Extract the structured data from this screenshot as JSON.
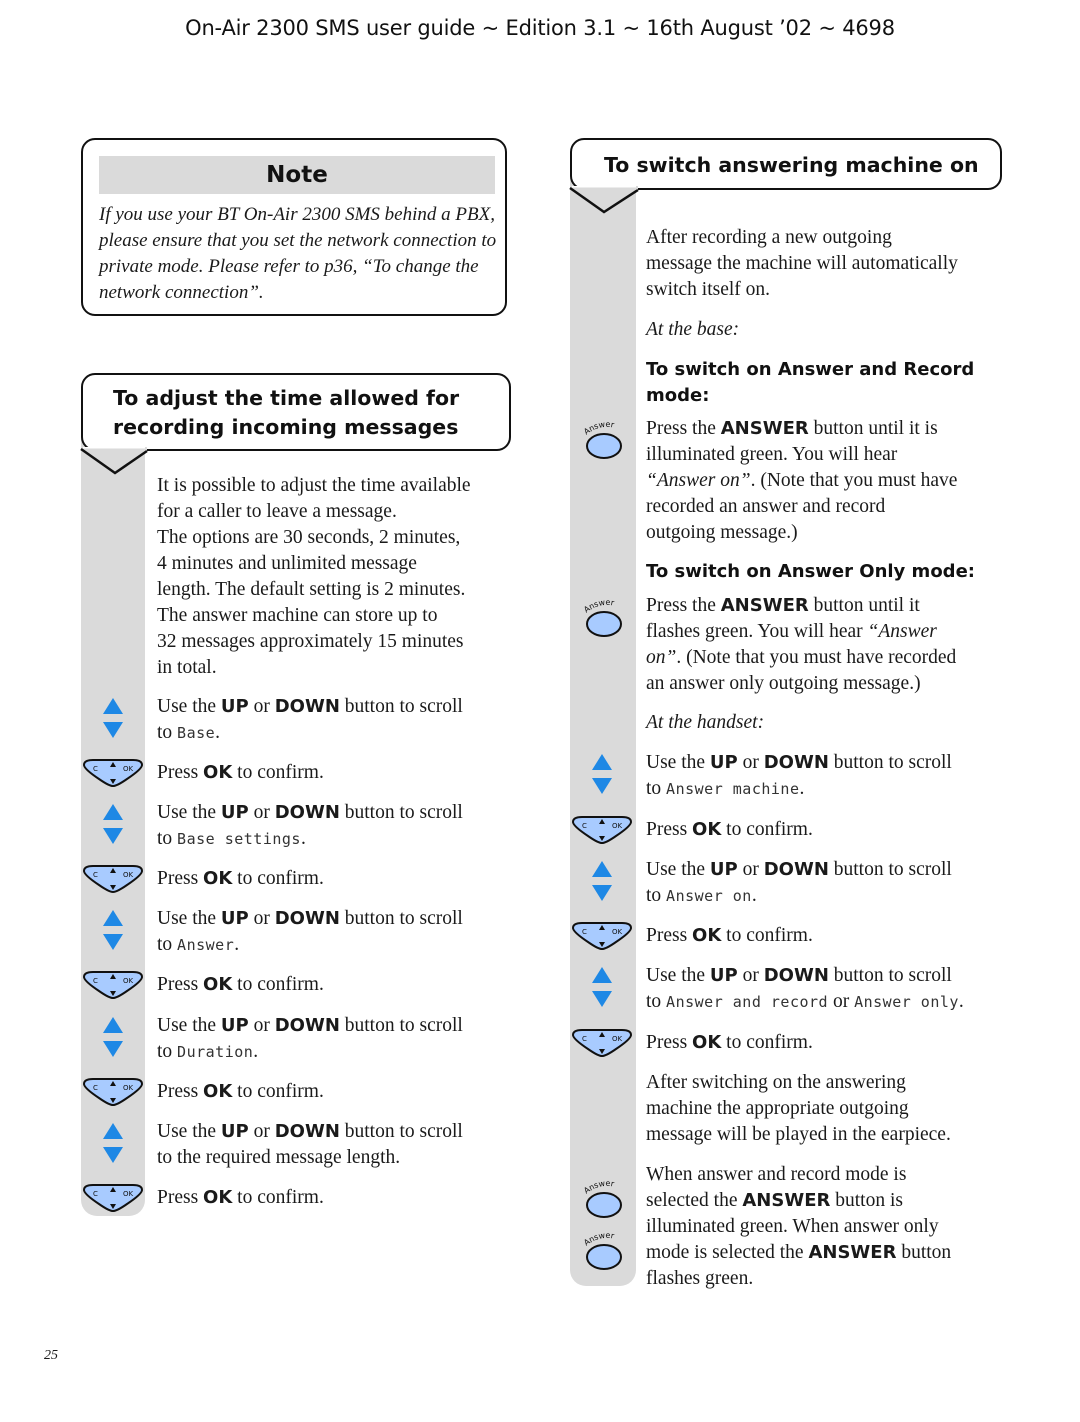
{
  "header": {
    "title": "On-Air 2300 SMS user guide ~ Edition 3.1 ~ 16th August ’02 ~ 4698"
  },
  "note": {
    "title": "Note",
    "text": "If you use your BT On-Air 2300 SMS behind a PBX, please ensure that you set the network connection to private mode. Please refer to p36, “To change the network connection”."
  },
  "left_section": {
    "title_line1": "To adjust the time allowed for",
    "title_line2": "recording incoming messages",
    "intro": [
      "It is possible to adjust the time available",
      "for a caller to leave a message.",
      "The options are 30 seconds, 2 minutes,",
      "4 minutes and unlimited message",
      "length. The default setting is 2 minutes.",
      "The answer machine can store up to",
      "32 messages approximately 15 minutes",
      "in total."
    ],
    "steps": [
      {
        "type": "scroll",
        "pre": "Use the",
        "up": "UP",
        "or": "or",
        "down": "DOWN",
        "post": "button to scroll",
        "to": "to",
        "target": "Base",
        "end": "."
      },
      {
        "type": "ok",
        "pre": "Press",
        "key": "OK",
        "post": "to confirm."
      },
      {
        "type": "scroll",
        "pre": "Use the",
        "up": "UP",
        "or": "or",
        "down": "DOWN",
        "post": "button to scroll",
        "to": "to",
        "target": "Base settings",
        "end": "."
      },
      {
        "type": "ok",
        "pre": "Press",
        "key": "OK",
        "post": "to confirm."
      },
      {
        "type": "scroll",
        "pre": "Use the",
        "up": "UP",
        "or": "or",
        "down": "DOWN",
        "post": "button to scroll",
        "to": "to",
        "target": "Answer",
        "end": "."
      },
      {
        "type": "ok",
        "pre": "Press",
        "key": "OK",
        "post": "to confirm."
      },
      {
        "type": "scroll",
        "pre": "Use the",
        "up": "UP",
        "or": "or",
        "down": "DOWN",
        "post": "button to scroll",
        "to": "to",
        "target": "Duration",
        "end": "."
      },
      {
        "type": "ok",
        "pre": "Press",
        "key": "OK",
        "post": "to confirm."
      },
      {
        "type": "scroll",
        "pre": "Use  the",
        "up": "UP",
        "or": "or",
        "down": "DOWN",
        "post": "button to scroll",
        "to": "to the required message length.",
        "target": "",
        "end": ""
      },
      {
        "type": "ok",
        "pre": "Press",
        "key": "OK",
        "post": "to confirm."
      }
    ]
  },
  "right_section": {
    "title": "To switch answering machine on",
    "intro": [
      "After recording a new outgoing",
      "message the machine will automatically",
      "switch itself on."
    ],
    "at_base": "At the base:",
    "sub1": {
      "line1": "To switch on Answer and Record",
      "line2": "mode:"
    },
    "sub1_text": {
      "p1": "Press the",
      "key": "ANSWER",
      "p2": "button until it is",
      "l2": "illuminated green. You will hear",
      "q": "“Answer on”",
      "l3": ". (Note that you must have",
      "l4": "recorded an answer and record",
      "l5": "outgoing message.)"
    },
    "sub2": "To switch on Answer Only mode:",
    "sub2_text": {
      "p1": "Press the",
      "key": "ANSWER",
      "p2": "button until it",
      "l2a": "flashes green. You will hear",
      "q1": "“Answer",
      "q2": "on”",
      "l3": ". (Note that you must have recorded",
      "l4": "an answer only outgoing message.)"
    },
    "at_handset": "At the handset:",
    "steps": [
      {
        "type": "scroll",
        "pre": "Use the",
        "up": "UP",
        "or": "or",
        "down": "DOWN",
        "post": "button to scroll",
        "to": "to",
        "target": "Answer machine",
        "end": "."
      },
      {
        "type": "ok",
        "pre": "Press",
        "key": "OK",
        "post": "to confirm."
      },
      {
        "type": "scroll",
        "pre": "Use the",
        "up": "UP",
        "or": "or",
        "down": "DOWN",
        "post": "button to scroll",
        "to": "to",
        "target": "Answer on",
        "end": "."
      },
      {
        "type": "ok",
        "pre": "Press",
        "key": "OK",
        "post": "to confirm."
      },
      {
        "type": "scroll2",
        "pre": "Use the",
        "up": "UP",
        "or": "or",
        "down": "DOWN",
        "post": "button to scroll",
        "to": "to",
        "target": "Answer and record",
        "mid": "or",
        "target2": "Answer only",
        "end": "."
      },
      {
        "type": "ok",
        "pre": "Press",
        "key": "OK",
        "post": "to confirm."
      }
    ],
    "after": [
      "After switching on the answering",
      "machine the appropriate outgoing",
      "message will be played in the earpiece."
    ],
    "final": {
      "l1": "When answer and record mode is",
      "l2a": "selected the",
      "key": "ANSWER",
      "l2b": "button is",
      "l3": "illuminated green. When answer only",
      "l4a": "mode is selected the",
      "l4b": "button",
      "l5": "flashes green."
    }
  },
  "icons": {
    "answer_label": "Answer",
    "nav_c": "C",
    "nav_ok": "OK"
  },
  "colors": {
    "icon_blue": "#1e88e5",
    "button_fill": "#a8cbff",
    "rail_gray": "#dadada"
  },
  "footer": {
    "page_number": "25"
  }
}
